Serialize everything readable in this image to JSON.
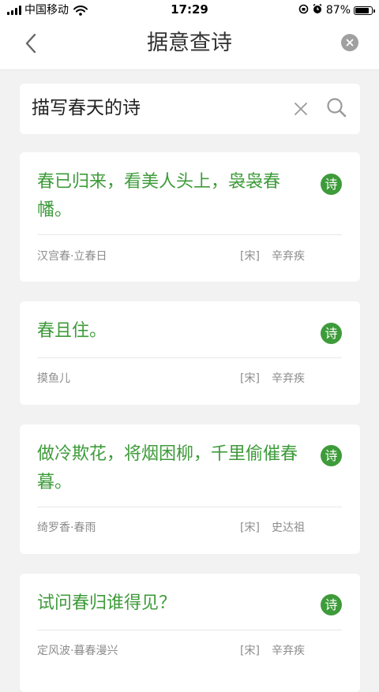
{
  "status_bar": {
    "carrier": "中国移动",
    "time": "17:29",
    "battery": "87%",
    "battery_level": 0.87
  },
  "header": {
    "title": "据意查诗"
  },
  "search": {
    "query": "描写春天的诗"
  },
  "results": [
    {
      "line": "春已归来，看美人头上，袅袅春幡。",
      "badge": "诗",
      "title": "汉宫春·立春日",
      "dynasty": "[宋]",
      "author": "辛弃疾"
    },
    {
      "line": "春且住。",
      "badge": "诗",
      "title": "摸鱼儿",
      "dynasty": "[宋]",
      "author": "辛弃疾"
    },
    {
      "line": "做冷欺花，将烟困柳，千里偷催春暮。",
      "badge": "诗",
      "title": "绮罗香·春雨",
      "dynasty": "[宋]",
      "author": "史达祖"
    },
    {
      "line": "试问春归谁得见？",
      "badge": "诗",
      "title": "定风波·暮春漫兴",
      "dynasty": "[宋]",
      "author": "辛弃疾"
    }
  ],
  "colors": {
    "accent": "#3e9b3a",
    "background": "#f2f2f2",
    "meta_text": "#8c8c8c"
  },
  "icons": [
    "signal-icon",
    "wifi-icon",
    "rotation-lock-icon",
    "alarm-icon",
    "battery-icon",
    "back-arrow-icon",
    "close-icon",
    "clear-icon",
    "search-icon"
  ]
}
